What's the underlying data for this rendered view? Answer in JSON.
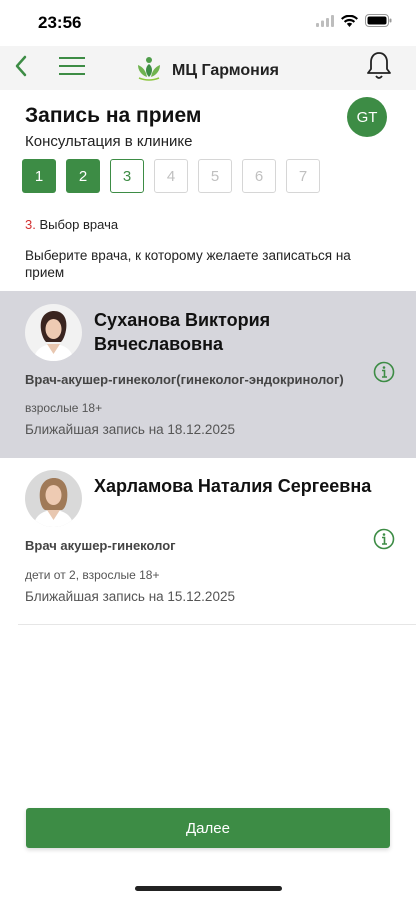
{
  "status_bar": {
    "time": "23:56"
  },
  "header": {
    "brand_name": "МЦ Гармония"
  },
  "colors": {
    "accent": "#3d8c45",
    "selected_bg": "#d6d6dc",
    "step_number": "#d32f2f"
  },
  "page": {
    "title": "Запись на прием",
    "subtitle": "Консультация в клинике",
    "user_initials": "GT"
  },
  "steps": [
    {
      "label": "1",
      "state": "done"
    },
    {
      "label": "2",
      "state": "done"
    },
    {
      "label": "3",
      "state": "current"
    },
    {
      "label": "4",
      "state": "future"
    },
    {
      "label": "5",
      "state": "future"
    },
    {
      "label": "6",
      "state": "future"
    },
    {
      "label": "7",
      "state": "future"
    }
  ],
  "step_label": {
    "number": "3.",
    "text": " Выбор врача"
  },
  "instruction": "Выберите врача, к которому желаете записаться на прием",
  "doctors": [
    {
      "name": "Суханова Виктория Вячеславовна",
      "specialty": "Врач-акушер-гинеколог(гинеколог-эндокринолог)",
      "age_group": "взрослые 18+",
      "next_appointment": "Ближайшая запись на 18.12.2025",
      "selected": true
    },
    {
      "name": "Харламова Наталия Сергеевна",
      "specialty": "Врач акушер-гинеколог",
      "age_group": "дети от 2, взрослые 18+",
      "next_appointment": "Ближайшая запись на 15.12.2025",
      "selected": false
    }
  ],
  "footer": {
    "next_button": "Далее"
  }
}
